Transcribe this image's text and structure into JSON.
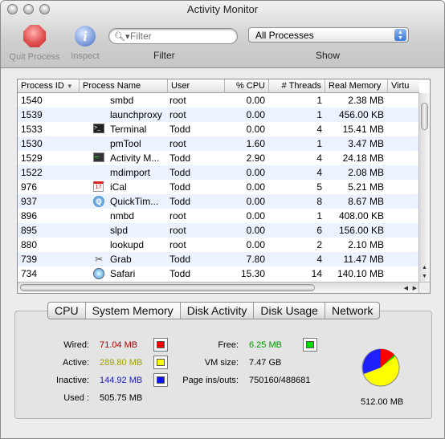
{
  "window": {
    "title": "Activity Monitor"
  },
  "toolbar": {
    "quit_label": "Quit Process",
    "inspect_label": "Inspect",
    "filter_placeholder": "Filter",
    "filter_label": "Filter",
    "show_value": "All Processes",
    "show_label": "Show"
  },
  "table": {
    "columns": [
      "Process ID",
      "Process Name",
      "User",
      "% CPU",
      "# Threads",
      "Real Memory",
      "Virtu"
    ],
    "rows": [
      {
        "pid": "1540",
        "name": "smbd",
        "icon": "",
        "user": "root",
        "cpu": "0.00",
        "threads": "1",
        "mem": "2.38 MB"
      },
      {
        "pid": "1539",
        "name": "launchproxy",
        "icon": "",
        "user": "root",
        "cpu": "0.00",
        "threads": "1",
        "mem": "456.00 KB"
      },
      {
        "pid": "1533",
        "name": "Terminal",
        "icon": "terminal-icon",
        "user": "Todd",
        "cpu": "0.00",
        "threads": "4",
        "mem": "15.41 MB"
      },
      {
        "pid": "1530",
        "name": "pmTool",
        "icon": "",
        "user": "root",
        "cpu": "1.60",
        "threads": "1",
        "mem": "3.47 MB"
      },
      {
        "pid": "1529",
        "name": "Activity M...",
        "icon": "activity-monitor-icon",
        "user": "Todd",
        "cpu": "2.90",
        "threads": "4",
        "mem": "24.18 MB"
      },
      {
        "pid": "1522",
        "name": "mdimport",
        "icon": "",
        "user": "Todd",
        "cpu": "0.00",
        "threads": "4",
        "mem": "2.08 MB"
      },
      {
        "pid": "976",
        "name": "iCal",
        "icon": "ical-icon",
        "user": "Todd",
        "cpu": "0.00",
        "threads": "5",
        "mem": "5.21 MB"
      },
      {
        "pid": "937",
        "name": "QuickTim...",
        "icon": "quicktime-icon",
        "user": "Todd",
        "cpu": "0.00",
        "threads": "8",
        "mem": "8.67 MB"
      },
      {
        "pid": "896",
        "name": "nmbd",
        "icon": "",
        "user": "root",
        "cpu": "0.00",
        "threads": "1",
        "mem": "408.00 KB"
      },
      {
        "pid": "895",
        "name": "slpd",
        "icon": "",
        "user": "root",
        "cpu": "0.00",
        "threads": "6",
        "mem": "156.00 KB"
      },
      {
        "pid": "880",
        "name": "lookupd",
        "icon": "",
        "user": "root",
        "cpu": "0.00",
        "threads": "2",
        "mem": "2.10 MB"
      },
      {
        "pid": "739",
        "name": "Grab",
        "icon": "grab-icon",
        "user": "Todd",
        "cpu": "7.80",
        "threads": "4",
        "mem": "11.47 MB"
      },
      {
        "pid": "734",
        "name": "Safari",
        "icon": "safari-icon",
        "user": "Todd",
        "cpu": "15.30",
        "threads": "14",
        "mem": "140.10 MB"
      }
    ]
  },
  "tabs": [
    "CPU",
    "System Memory",
    "Disk Activity",
    "Disk Usage",
    "Network"
  ],
  "memory": {
    "wired_label": "Wired:",
    "wired": "71.04 MB",
    "wired_color": "#d10000",
    "active_label": "Active:",
    "active": "289.80 MB",
    "active_color": "#a8a800",
    "inactive_label": "Inactive:",
    "inactive": "144.92 MB",
    "inactive_color": "#1a1acc",
    "used_label": "Used :",
    "used": "505.75 MB",
    "free_label": "Free:",
    "free": "6.25 MB",
    "free_color": "#00a000",
    "vm_label": "VM size:",
    "vm": "7.47 GB",
    "pageins_label": "Page ins/outs:",
    "pageins": "750160/488681",
    "total": "512.00 MB"
  }
}
